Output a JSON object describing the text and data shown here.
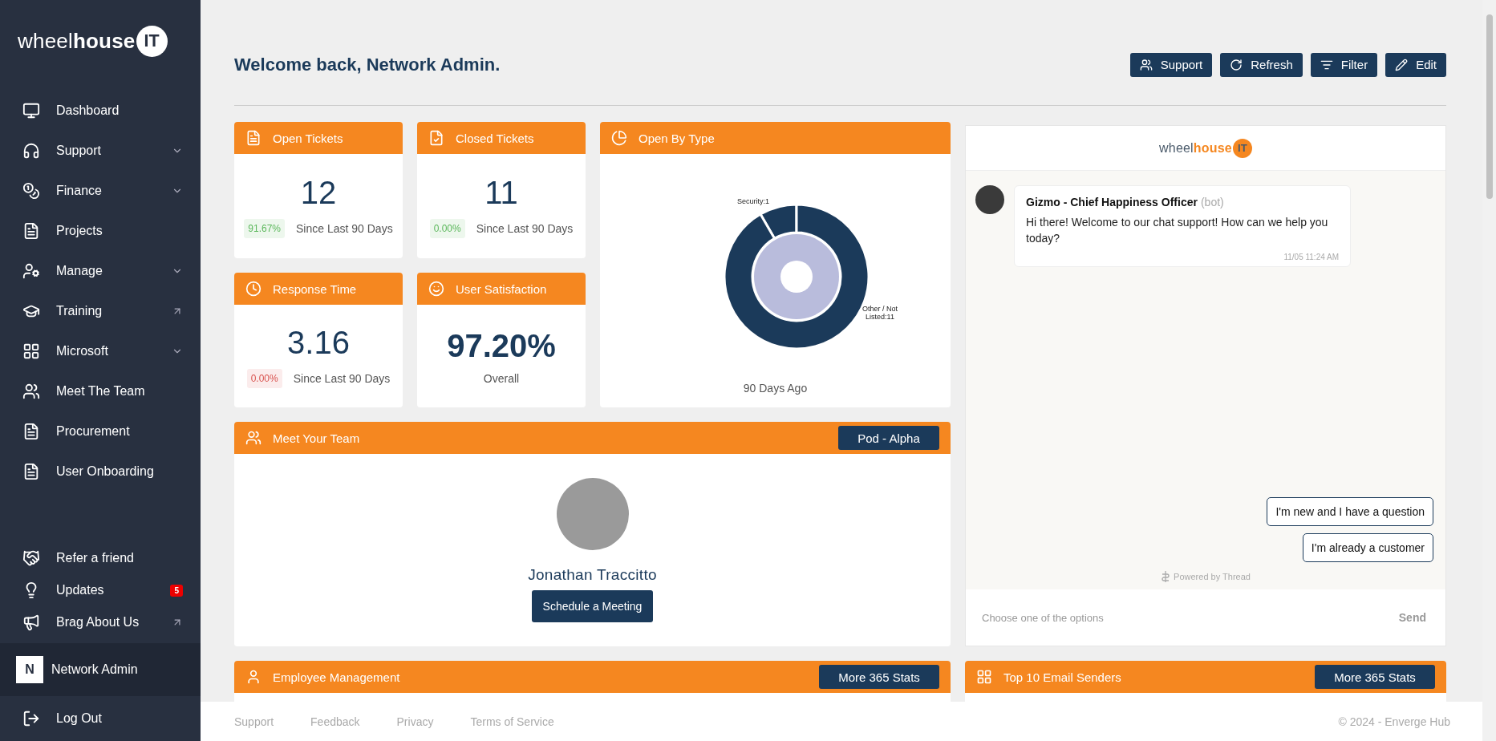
{
  "sidebar": {
    "logo": {
      "light": "wheel",
      "bold": "house",
      "badge": "IT"
    },
    "items": [
      {
        "label": "Dashboard",
        "kind": "page"
      },
      {
        "label": "Support",
        "kind": "menu"
      },
      {
        "label": "Finance",
        "kind": "menu"
      },
      {
        "label": "Projects",
        "kind": "page"
      },
      {
        "label": "Manage",
        "kind": "menu"
      },
      {
        "label": "Training",
        "kind": "external"
      },
      {
        "label": "Microsoft",
        "kind": "menu"
      },
      {
        "label": "Meet The Team",
        "kind": "page"
      },
      {
        "label": "Procurement",
        "kind": "page"
      },
      {
        "label": "User Onboarding",
        "kind": "page"
      }
    ],
    "extras": [
      {
        "label": "Refer a friend",
        "kind": "page"
      },
      {
        "label": "Updates",
        "kind": "badge",
        "badge": "5"
      },
      {
        "label": "Brag About Us",
        "kind": "external"
      }
    ],
    "user": {
      "initial": "N",
      "name": "Network Admin"
    },
    "logout": "Log Out"
  },
  "header": {
    "title": "Welcome back, Network Admin.",
    "buttons": [
      "Support",
      "Refresh",
      "Filter",
      "Edit"
    ]
  },
  "stats": [
    {
      "title": "Open Tickets",
      "value": "12",
      "delta": "91.67%",
      "color": "#5cb85c",
      "caption": "Since Last 90 Days"
    },
    {
      "title": "Closed Tickets",
      "value": "11",
      "delta": "0.00%",
      "color": "#5cb85c",
      "caption": "Since Last 90 Days"
    },
    {
      "title": "Response Time",
      "value": "3.16",
      "delta": "0.00%",
      "color": "#d9534f",
      "caption": "Since Last 90 Days"
    },
    {
      "title": "User Satisfaction",
      "value": "97.20%",
      "caption": "Overall"
    }
  ],
  "open_by_type": {
    "title": "Open By Type",
    "caption": "90 Days Ago",
    "chart_data": {
      "type": "donut",
      "values": [
        1,
        11
      ],
      "value_labels": [
        "Security:1",
        "Other / Not Listed:11"
      ]
    }
  },
  "chat": {
    "logo": {
      "light": "wheel",
      "bold": "house",
      "badge": "IT"
    },
    "sender": "Gizmo - Chief Happiness Officer",
    "sender_tag": "(bot)",
    "message": "Hi there! Welcome to our chat support! How can we help you today?",
    "time": "11/05 11:24 AM",
    "options": [
      "I'm new and I have a question",
      "I'm already a customer"
    ],
    "powered": "Powered by Thread",
    "placeholder": "Choose one of the options",
    "send": "Send"
  },
  "team": {
    "title": "Meet Your Team",
    "pod": "Pod - Alpha",
    "name": "Jonathan Traccitto",
    "action": "Schedule a Meeting"
  },
  "bottom_panels": [
    {
      "title": "Employee Management",
      "action": "More 365 Stats"
    },
    {
      "title": "Top 10 Email Senders",
      "action": "More 365 Stats"
    }
  ],
  "footer": {
    "links": [
      "Support",
      "Feedback",
      "Privacy",
      "Terms of Service"
    ],
    "copyright": "© 2024 - Enverge Hub"
  }
}
